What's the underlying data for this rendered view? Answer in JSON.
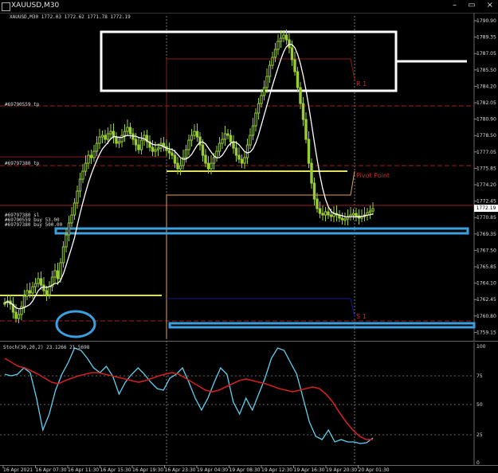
{
  "window": {
    "title": "XAUUSD,M30",
    "buttons": [
      "–",
      "▭",
      "×"
    ]
  },
  "ohlc_info": "XAUUSD,M30  1772.03 1772.62 1771.78 1772.19",
  "current_price": "1772.19",
  "price_axis": [
    "1790.90",
    "1789.35",
    "1787.05",
    "1785.50",
    "1784.20",
    "1782.05",
    "1780.90",
    "1778.50",
    "1777.05",
    "1775.85",
    "1774.20",
    "1772.45",
    "1770.85",
    "1769.35",
    "1767.50",
    "1765.85",
    "1764.10",
    "1762.45",
    "1760.80",
    "1759.15"
  ],
  "time_axis": [
    "16 Apr 2021",
    "16 Apr 07:30",
    "16 Apr 11:30",
    "16 Apr 15:30",
    "16 Apr 19:30",
    "16 Apr 23:30",
    "19 Apr 04:30",
    "19 Apr 08:30",
    "19 Apr 12:30",
    "19 Apr 16:30",
    "19 Apr 20:30",
    "20 Apr 01:30"
  ],
  "orders": {
    "tp1": "#69790559 tp",
    "tp2": "#69797380 tp",
    "o1": "#69797380 sl",
    "o2": "#69790559 buy 53.00",
    "o3": "#69797380 buy 500.00"
  },
  "pivots": {
    "r1": "R 1",
    "pp": "Pivot Point",
    "s1": "S 1"
  },
  "stoch": {
    "label": "Stoch(30,20,2) 23.1266 21.5698",
    "levels": [
      "100",
      "75",
      "50",
      "25",
      "0"
    ]
  },
  "colors": {
    "background": "#000000",
    "candle": "#9acd32",
    "ma": "#ffffff",
    "pivot_r": "#8b1a1a",
    "pivot_pp": "#e0e060",
    "pivot_s": "#1a1a8b",
    "highlight": "#3aa0e0",
    "stoch_main": "#5fd0f0",
    "stoch_signal": "#d02020"
  },
  "icons": {
    "title": "chart-window-icon",
    "circle": "circle-highlight-icon"
  }
}
